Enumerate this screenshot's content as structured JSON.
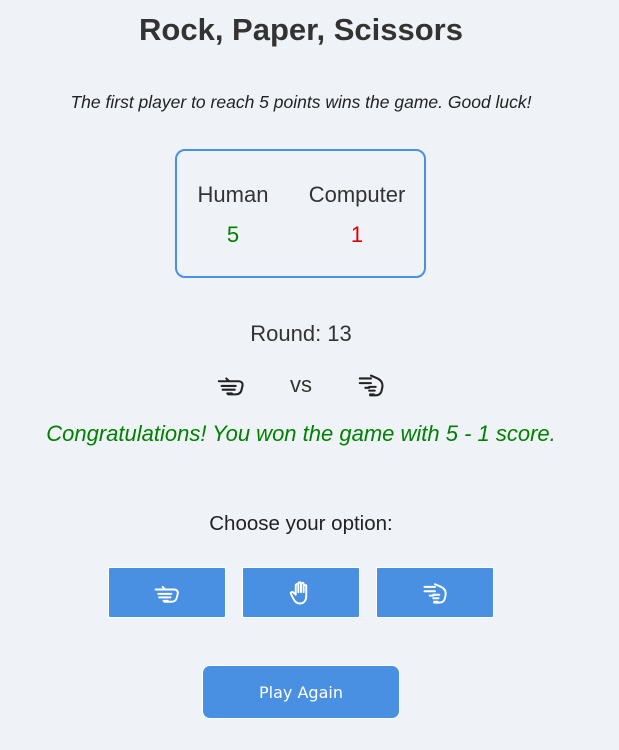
{
  "title": "Rock, Paper, Scissors",
  "subtitle": "The first player to reach 5 points wins the game. Good luck!",
  "scoreboard": {
    "human_label": "Human",
    "human_score": "5",
    "computer_label": "Computer",
    "computer_score": "1"
  },
  "round": {
    "label": "Round:",
    "number": "13"
  },
  "matchup": {
    "human_choice_icon": "hand-rock-icon",
    "vs": "vs",
    "computer_choice_icon": "hand-scissors-icon"
  },
  "result": "Congratulations! You won the game with 5 - 1 score.",
  "choose_label": "Choose your option:",
  "options": [
    {
      "icon": "hand-rock-icon"
    },
    {
      "icon": "hand-paper-icon"
    },
    {
      "icon": "hand-scissors-icon"
    }
  ],
  "play_again_label": "Play Again",
  "colors": {
    "accent": "#4a90e2",
    "win": "#008000",
    "lose": "#e00000",
    "background": "#eff3f8"
  }
}
